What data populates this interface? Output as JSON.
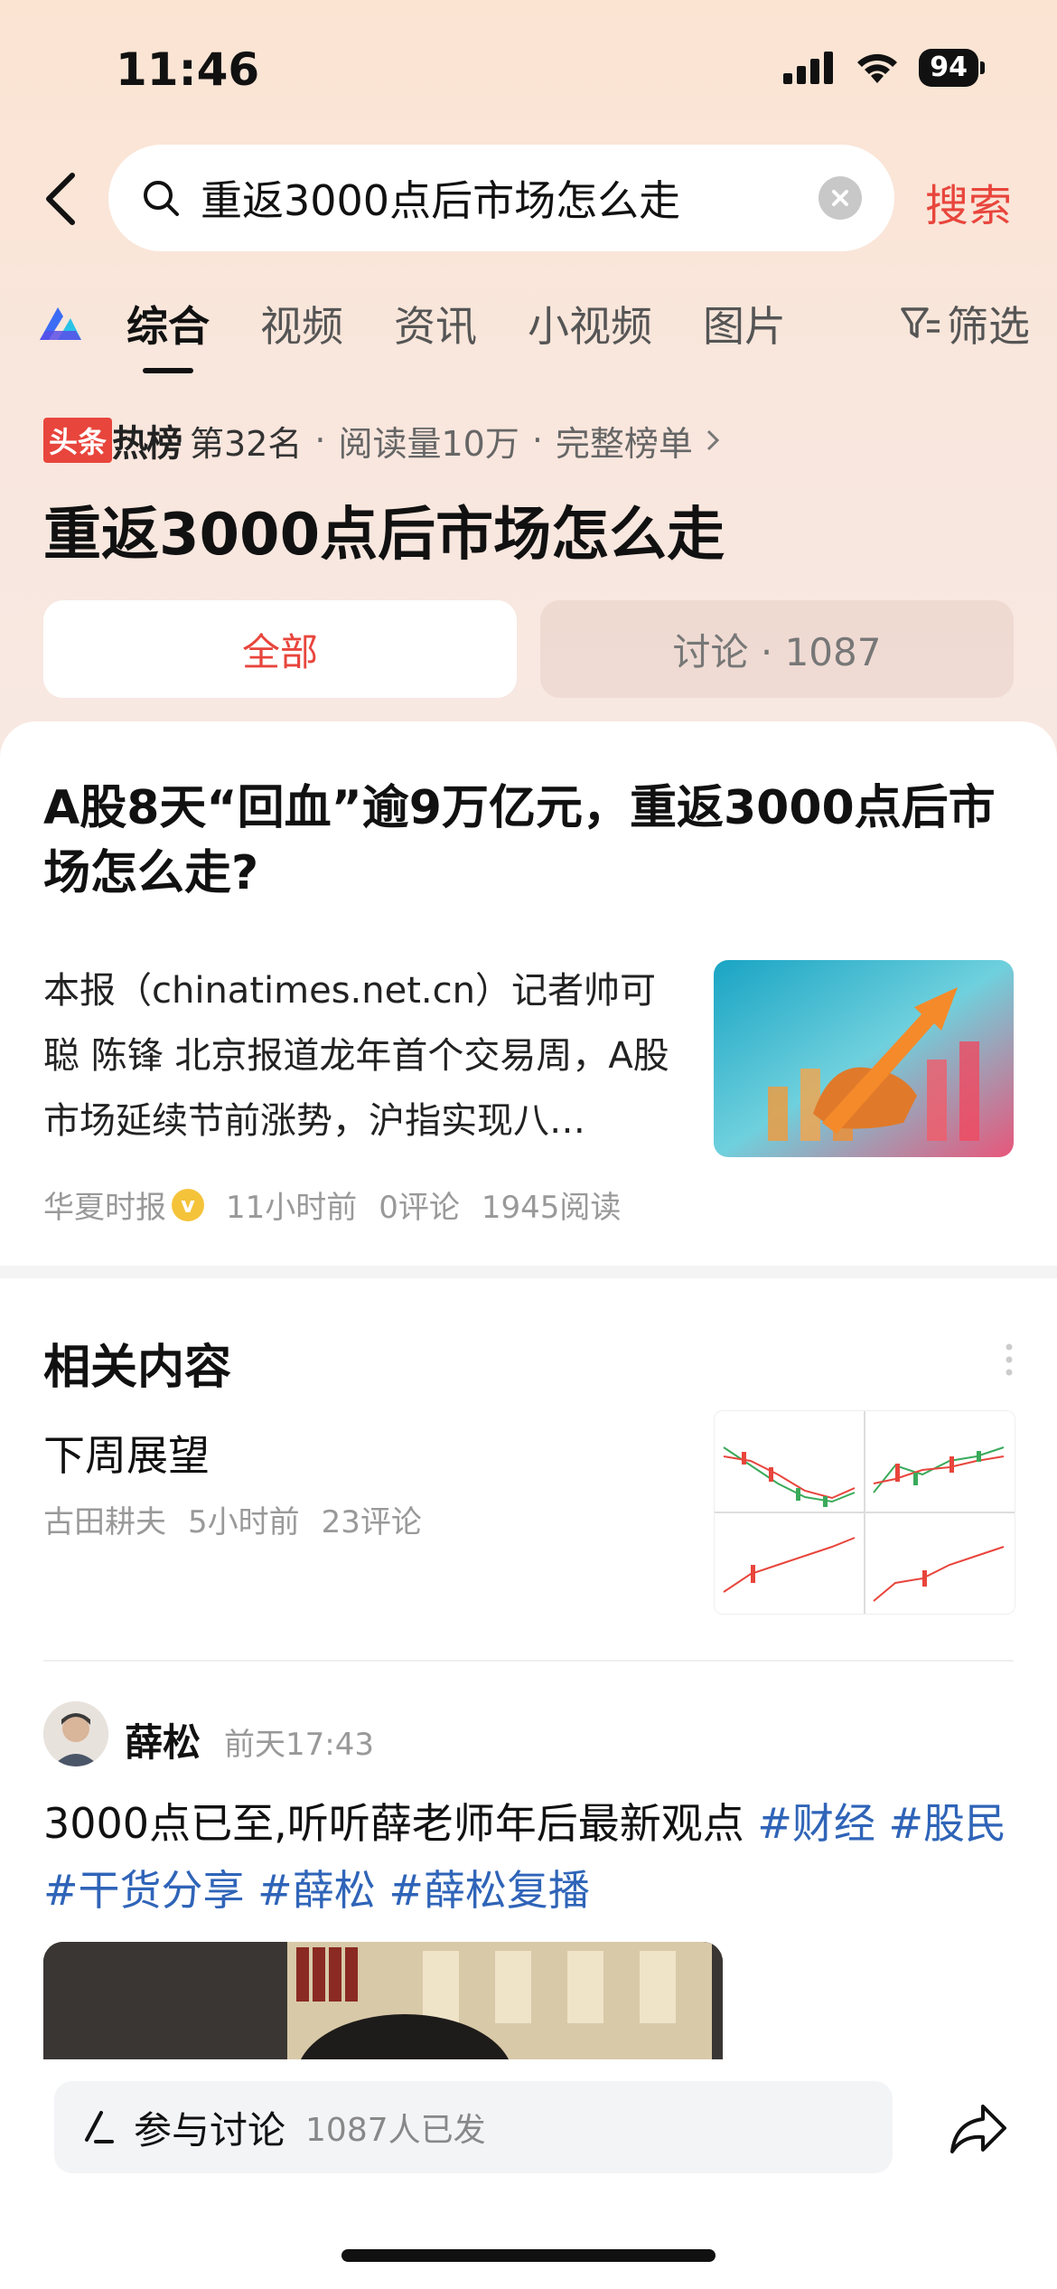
{
  "status_bar": {
    "time": "11:46",
    "battery": "94"
  },
  "search": {
    "query": "重返3000点后市场怎么走",
    "button": "搜索"
  },
  "tabs": [
    {
      "label": "综合"
    },
    {
      "label": "视频"
    },
    {
      "label": "资讯"
    },
    {
      "label": "小视频"
    },
    {
      "label": "图片"
    },
    {
      "label": "筛选"
    }
  ],
  "hot": {
    "badge": "头条",
    "rebang": "热榜",
    "rank": "第32名",
    "reads": "阅读量10万",
    "full_list": "完整榜单",
    "title": "重返3000点后市场怎么走"
  },
  "segments": {
    "all": "全部",
    "discussion": "讨论 · 1087"
  },
  "article": {
    "title": "A股8天“回血”逾9万亿元，重返3000点后市场怎么走?",
    "summary": "本报（chinatimes.net.cn）记者帅可聪 陈锋 北京报道龙年首个交易周，A股市场延续节前涨势，沪指实现八…",
    "source": "华夏时报",
    "verified": "v",
    "time": "11小时前",
    "comments": "0评论",
    "reads": "1945阅读"
  },
  "related": {
    "heading": "相关内容",
    "item": {
      "title": "下周展望",
      "author": "古田耕夫",
      "time": "5小时前",
      "comments": "23评论"
    }
  },
  "post": {
    "author": "薛松",
    "time": "前天17:43",
    "text": "3000点已至,听听薛老师年后最新观点 ",
    "hashtags": [
      "#财经",
      "#股民",
      "#干货分享",
      "#薛松",
      "#薛松复播"
    ]
  },
  "bottom": {
    "discuss_label": "参与讨论",
    "discuss_count": "1087人已发"
  },
  "colors": {
    "accent": "#e8453c",
    "hashtag": "#2f64b8"
  }
}
